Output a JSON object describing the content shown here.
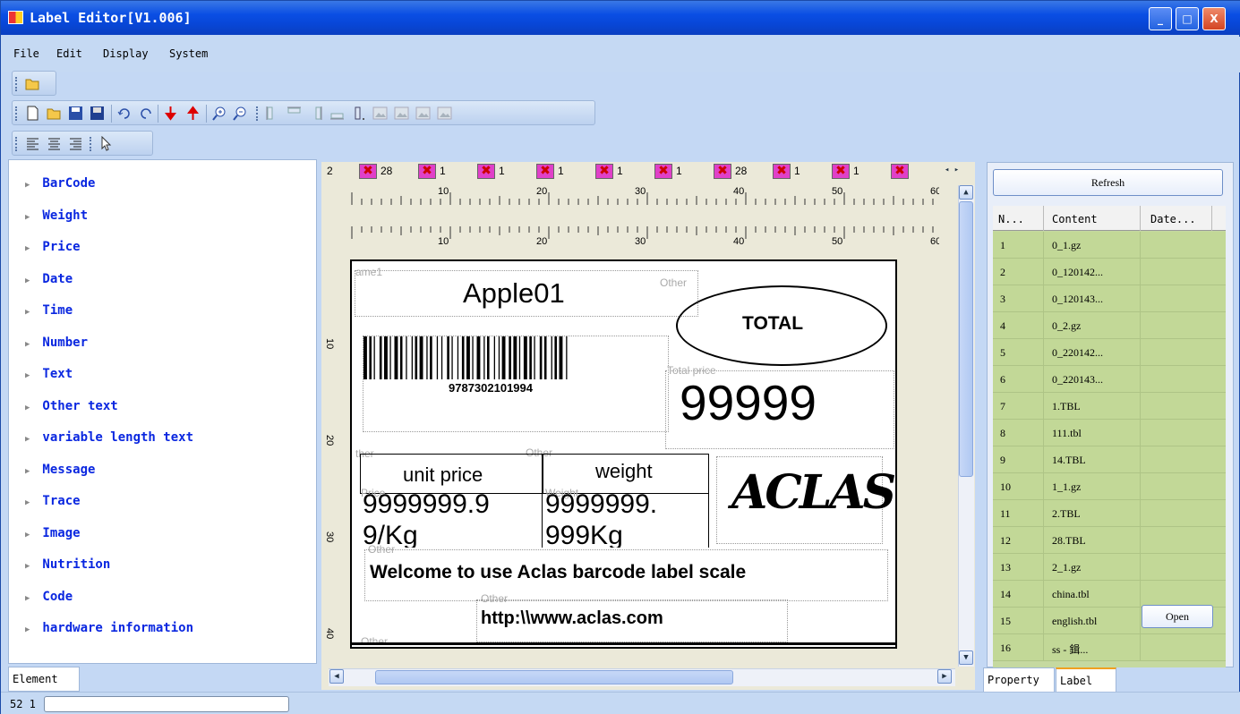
{
  "window": {
    "title": "Label Editor[V1.006]",
    "controls": [
      "_",
      "□",
      "X"
    ]
  },
  "menu": {
    "items": [
      "File",
      "Edit",
      "Display",
      "System"
    ]
  },
  "elements": {
    "items": [
      "BarCode",
      "Weight",
      "Price",
      "Date",
      "Time",
      "Number",
      "Text",
      "Other text",
      "variable length text",
      "Message",
      "Trace",
      "Image",
      "Nutrition",
      "Code",
      "hardware information"
    ],
    "tab": "Element"
  },
  "tabstrip": {
    "items": [
      "2",
      "28",
      "1",
      "1",
      "1",
      "1",
      "1",
      "28",
      "1",
      "1"
    ]
  },
  "ruler": {
    "top_numbers": [
      "10",
      "20",
      "30",
      "40",
      "50",
      "60"
    ],
    "left_numbers": [
      "10",
      "20",
      "30",
      "40"
    ]
  },
  "label": {
    "name_box_label": "ame1",
    "product_name": "Apple01",
    "other_label_1": "Other",
    "total_text": "TOTAL",
    "barcode_number": "9787302101994",
    "total_price_label": "Total price",
    "total_price_value": "99999",
    "other_label_2": "ther",
    "other_label_3": "Other",
    "unit_price_header": "unit  price",
    "weight_header": "weight",
    "price_value_line1": "9999999.9",
    "price_value_line2": "9/Kg",
    "weight_value_line1": "9999999.",
    "weight_value_line2": "999Kg",
    "price_label": "Price",
    "weight_label": "Weight",
    "logo_text": "ACLAS",
    "other_label_4": "Other",
    "welcome_text": "Welcome to use Aclas barcode label scale",
    "other_label_5": "Other",
    "url_text": "http:\\\\www.aclas.com",
    "other_label_6": "Other"
  },
  "right": {
    "refresh_label": "Refresh",
    "columns": [
      "N...",
      "Content",
      "Date..."
    ],
    "rows": [
      {
        "n": "1",
        "content": "0_1.gz"
      },
      {
        "n": "2",
        "content": "0_120142..."
      },
      {
        "n": "3",
        "content": "0_120143..."
      },
      {
        "n": "4",
        "content": "0_2.gz"
      },
      {
        "n": "5",
        "content": "0_220142..."
      },
      {
        "n": "6",
        "content": "0_220143..."
      },
      {
        "n": "7",
        "content": "1.TBL"
      },
      {
        "n": "8",
        "content": "111.tbl"
      },
      {
        "n": "9",
        "content": "14.TBL"
      },
      {
        "n": "10",
        "content": "1_1.gz"
      },
      {
        "n": "11",
        "content": "2.TBL"
      },
      {
        "n": "12",
        "content": "28.TBL"
      },
      {
        "n": "13",
        "content": "2_1.gz"
      },
      {
        "n": "14",
        "content": "china.tbl"
      },
      {
        "n": "15",
        "content": "english.tbl"
      },
      {
        "n": "16",
        "content": "ss - 鍓..."
      }
    ],
    "open_label": "Open",
    "tabs": [
      "Property",
      "Label"
    ]
  },
  "status": {
    "text": "52 1"
  }
}
